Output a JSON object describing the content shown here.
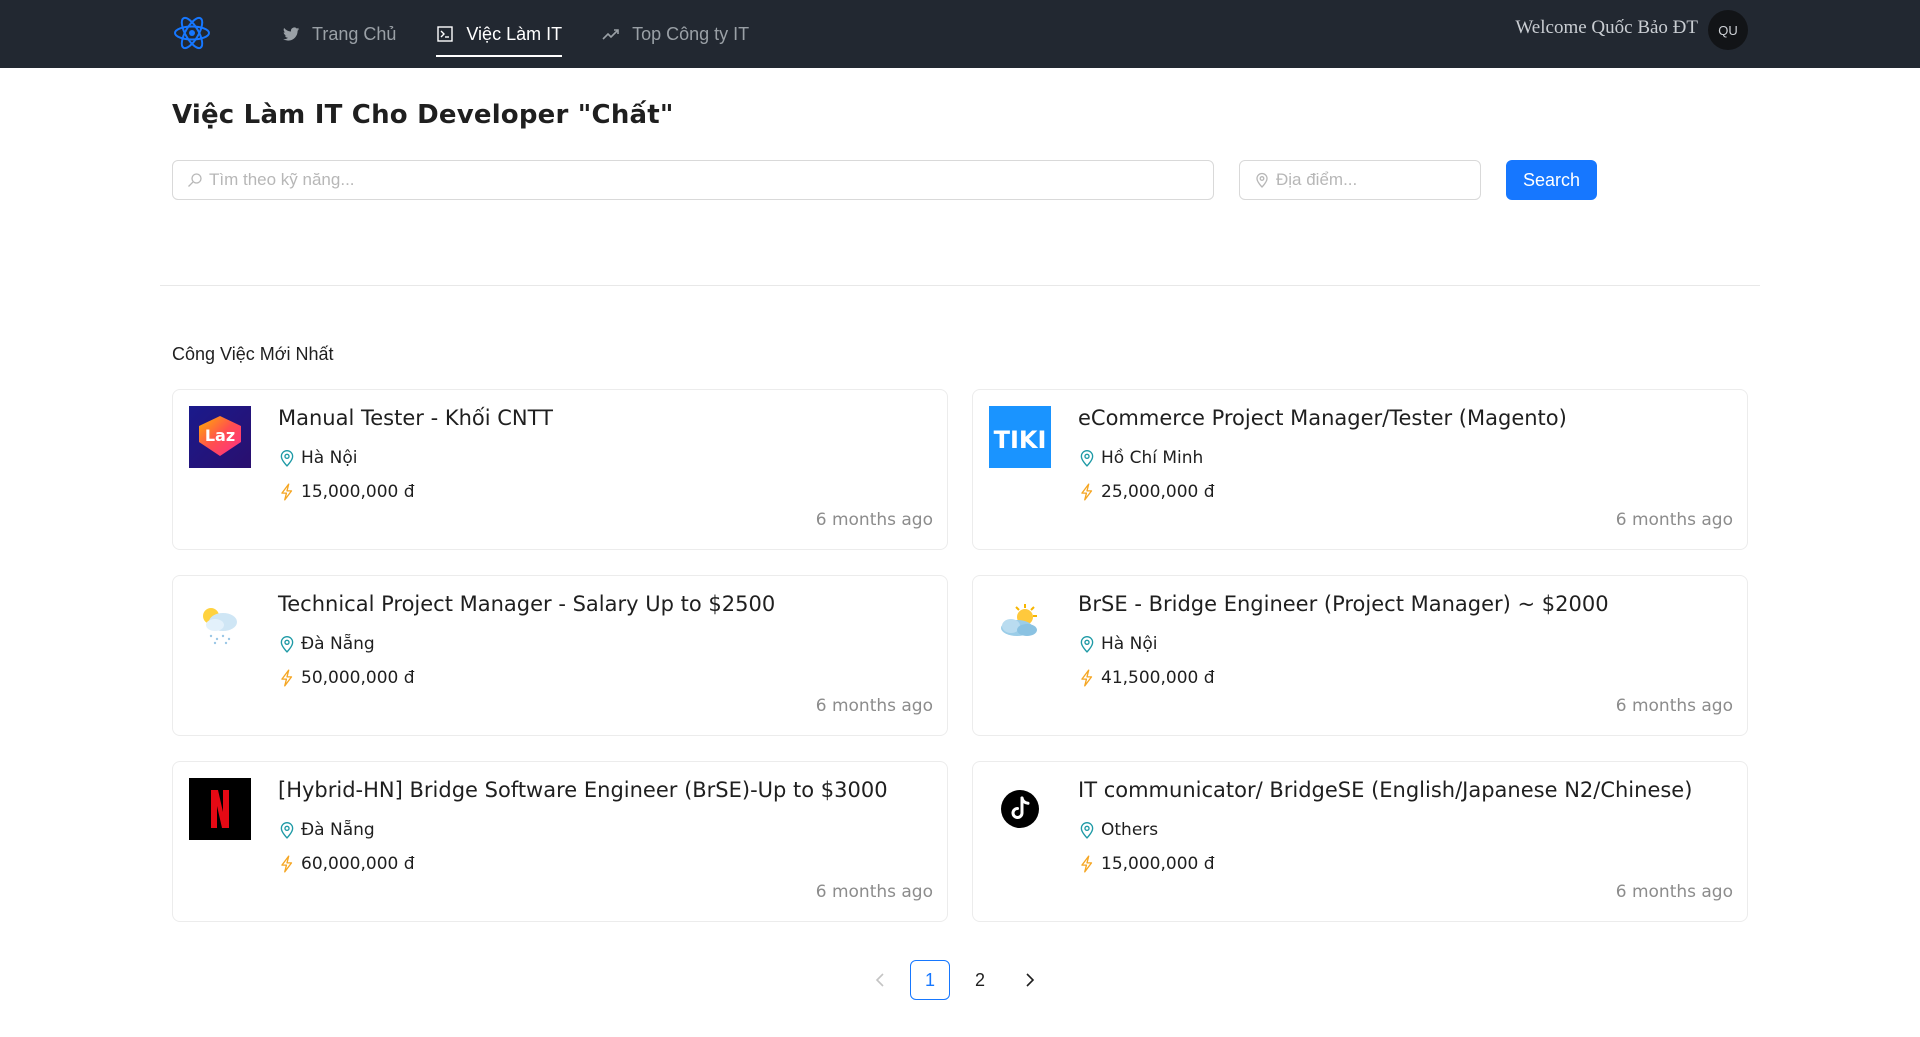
{
  "header": {
    "nav": [
      {
        "label": "Trang Chủ",
        "icon": "twitter-icon",
        "active": false
      },
      {
        "label": "Việc Làm IT",
        "icon": "terminal-icon",
        "active": true
      },
      {
        "label": "Top Công ty IT",
        "icon": "trend-line-icon",
        "active": false
      }
    ],
    "welcome": "Welcome Quốc Bảo ĐT",
    "avatar_initials": "QU"
  },
  "page": {
    "title": "Việc Làm IT Cho Developer \"Chất\"",
    "search": {
      "skill_placeholder": "Tìm theo kỹ năng...",
      "location_placeholder": "Địa điểm...",
      "button_label": "Search"
    },
    "section_title": "Công Việc Mới Nhất"
  },
  "jobs": [
    {
      "title": "Manual Tester - Khối CNTT",
      "location": "Hà Nội",
      "salary": "15,000,000 đ",
      "posted": "6 months ago",
      "logo": "lazada-logo"
    },
    {
      "title": "eCommerce Project Manager/Tester (Magento)",
      "location": "Hồ Chí Minh",
      "salary": "25,000,000 đ",
      "posted": "6 months ago",
      "logo": "tiki-logo"
    },
    {
      "title": "Technical Project Manager - Salary Up to $2500",
      "location": "Đà Nẵng",
      "salary": "50,000,000 đ",
      "posted": "6 months ago",
      "logo": "weather-snow-logo"
    },
    {
      "title": "BrSE - Bridge Engineer (Project Manager) ~ $2000",
      "location": "Hà Nội",
      "salary": "41,500,000 đ",
      "posted": "6 months ago",
      "logo": "weather-sun-cloud-logo"
    },
    {
      "title": "[Hybrid-HN] Bridge Software Engineer (BrSE)-Up to $3000",
      "location": "Đà Nẵng",
      "salary": "60,000,000 đ",
      "posted": "6 months ago",
      "logo": "netflix-logo"
    },
    {
      "title": "IT communicator/ BridgeSE (English/Japanese N2/Chinese)",
      "location": "Others",
      "salary": "15,000,000 đ",
      "posted": "6 months ago",
      "logo": "tiktok-logo"
    }
  ],
  "pagination": {
    "pages": [
      "1",
      "2"
    ],
    "current": "1"
  },
  "colors": {
    "header_bg": "#222831",
    "primary": "#1677ff",
    "location_icon": "#1f9aa6",
    "salary_icon": "#f5a623"
  }
}
